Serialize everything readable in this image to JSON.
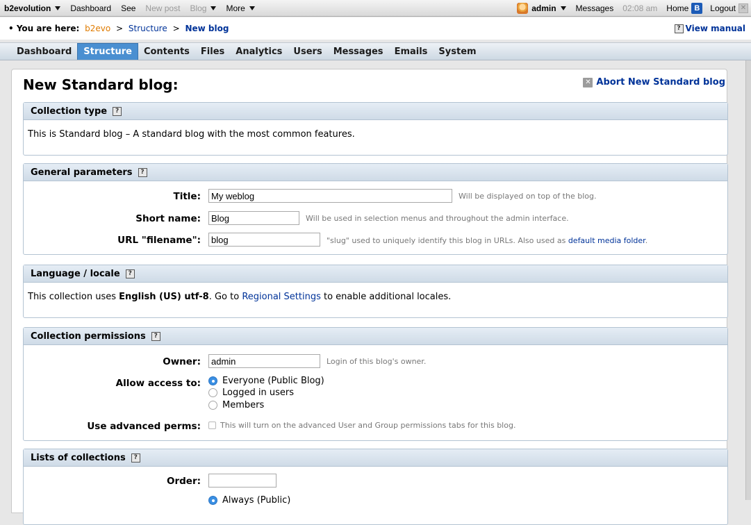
{
  "toolbar": {
    "brand": "b2evolution",
    "dashboard": "Dashboard",
    "see": "See",
    "new_post": "New post",
    "blog": "Blog",
    "more": "More",
    "admin": "admin",
    "messages": "Messages",
    "clock": "02:08 am",
    "home": "Home",
    "home_icon_letter": "B",
    "logout": "Logout"
  },
  "breadcrumb": {
    "lead": "• You are here:",
    "root": "b2evo",
    "sep1": ">",
    "structure": "Structure",
    "sep2": ">",
    "current": "New blog",
    "manual": "View manual"
  },
  "tabs": [
    {
      "label": "Dashboard",
      "active": false
    },
    {
      "label": "Structure",
      "active": true
    },
    {
      "label": "Contents",
      "active": false
    },
    {
      "label": "Files",
      "active": false
    },
    {
      "label": "Analytics",
      "active": false
    },
    {
      "label": "Users",
      "active": false
    },
    {
      "label": "Messages",
      "active": false
    },
    {
      "label": "Emails",
      "active": false
    },
    {
      "label": "System",
      "active": false
    }
  ],
  "page": {
    "title": "New Standard blog:",
    "abort": "Abort New Standard blog"
  },
  "collection_type": {
    "heading": "Collection type",
    "text": "This is Standard blog – A standard blog with the most common features."
  },
  "general": {
    "heading": "General parameters",
    "title_label": "Title:",
    "title_value": "My weblog",
    "title_note": "Will be displayed on top of the blog.",
    "short_label": "Short name:",
    "short_value": "Blog",
    "short_note": "Will be used in selection menus and throughout the admin interface.",
    "url_label": "URL \"filename\":",
    "url_value": "blog",
    "url_note": "\"slug\" used to uniquely identify this blog in URLs. Also used as",
    "url_note_link": "default media folder",
    "url_note_end": "."
  },
  "locale": {
    "heading": "Language / locale",
    "text_a": "This collection uses",
    "locale_name": "English (US) utf-8",
    "text_b": ". Go to",
    "link": "Regional Settings",
    "text_c": "to enable additional locales."
  },
  "permissions": {
    "heading": "Collection permissions",
    "owner_label": "Owner:",
    "owner_value": "admin",
    "owner_note": "Login of this blog's owner.",
    "access_label": "Allow access to:",
    "access_options": [
      "Everyone (Public Blog)",
      "Logged in users",
      "Members"
    ],
    "access_selected": "Everyone (Public Blog)",
    "adv_label": "Use advanced perms:",
    "adv_note": "This will turn on the advanced User and Group permissions tabs for this blog.",
    "adv_checked": false
  },
  "lists": {
    "heading": "Lists of collections",
    "order_label": "Order:",
    "order_value": "",
    "next_option": "Always (Public)"
  },
  "colors": {
    "tab_active": "#4a8fd1",
    "link_blue": "#003399",
    "link_orange": "#e07b00"
  }
}
